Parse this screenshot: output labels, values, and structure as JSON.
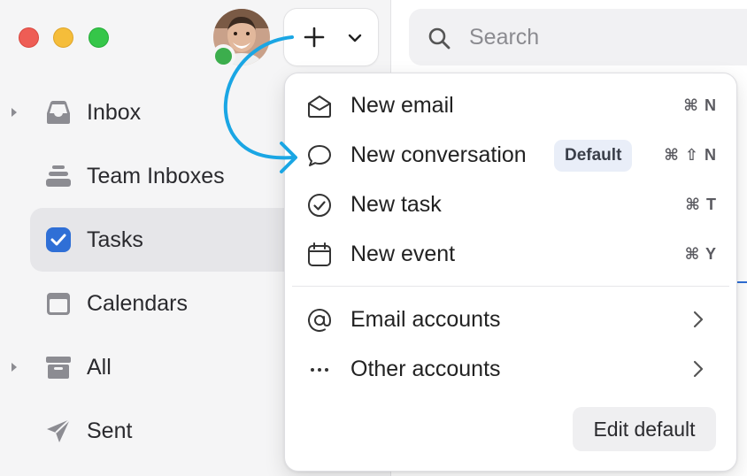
{
  "window": {
    "traffic_lights": [
      "close",
      "minimize",
      "zoom"
    ]
  },
  "header": {
    "compose_icon": "plus-icon",
    "compose_menu_icon": "chevron-down-icon",
    "presence_color": "#3cae4d"
  },
  "search": {
    "placeholder": "Search"
  },
  "sidebar": {
    "items": [
      {
        "label": "Inbox",
        "icon": "inbox-icon",
        "expandable": true,
        "active": false
      },
      {
        "label": "Team Inboxes",
        "icon": "stack-icon",
        "expandable": false,
        "active": false
      },
      {
        "label": "Tasks",
        "icon": "checkbox-icon",
        "expandable": false,
        "active": true
      },
      {
        "label": "Calendars",
        "icon": "calendar-icon",
        "expandable": false,
        "active": false
      },
      {
        "label": "All",
        "icon": "archive-icon",
        "expandable": true,
        "active": false
      },
      {
        "label": "Sent",
        "icon": "send-icon",
        "expandable": false,
        "active": false
      }
    ]
  },
  "menu": {
    "items": [
      {
        "label": "New email",
        "icon": "envelope-open-icon",
        "shortcut": "⌘ N"
      },
      {
        "label": "New conversation",
        "icon": "speech-bubble-icon",
        "shortcut": "⌘ ⇧ N",
        "badge": "Default"
      },
      {
        "label": "New task",
        "icon": "check-circle-icon",
        "shortcut": "⌘ T"
      },
      {
        "label": "New event",
        "icon": "calendar-icon",
        "shortcut": "⌘ Y"
      }
    ],
    "accounts": [
      {
        "label": "Email accounts",
        "icon": "at-sign-icon"
      },
      {
        "label": "Other accounts",
        "icon": "ellipsis-icon"
      }
    ],
    "edit_default_label": "Edit default"
  },
  "colors": {
    "accent": "#2f6fd6",
    "annotation_arrow": "#1aa6e4",
    "badge_bg": "#e9eef8"
  }
}
